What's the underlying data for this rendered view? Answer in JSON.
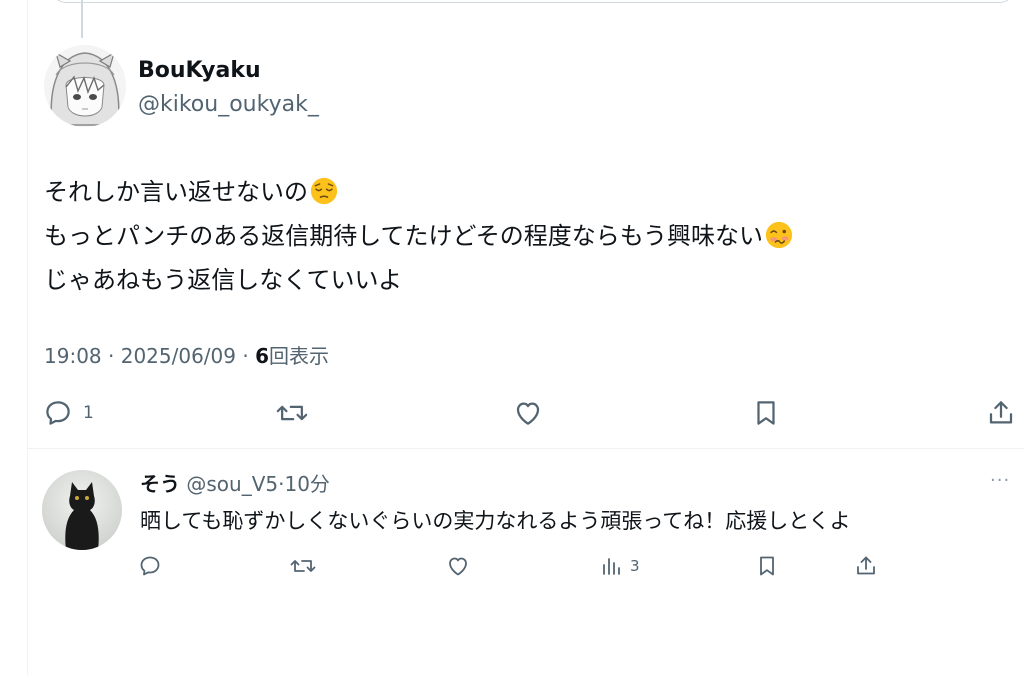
{
  "post": {
    "display_name": "BouKyaku",
    "handle": "@kikou_oukyak_",
    "lines": [
      {
        "text": "それしか言い返せないの",
        "emoji": "pensive-face"
      },
      {
        "text": "もっとパンチのある返信期待してたけどその程度ならもう興味ない",
        "emoji": "woozy-face"
      },
      {
        "text": "じゃあねもう返信しなくていいよ",
        "emoji": ""
      }
    ],
    "time": "19:08",
    "separator": "·",
    "date": "2025/06/09",
    "views_count": "6",
    "views_label": "回表示",
    "actions": {
      "reply_count": "1"
    }
  },
  "reply": {
    "display_name": "そう",
    "handle": "@sou_V5",
    "separator": "·",
    "time": "10分",
    "more": "···",
    "text": "晒しても恥ずかしくないぐらいの実力なれるよう頑張ってね！応援しとくよ",
    "actions": {
      "views_count": "3"
    }
  },
  "colors": {
    "text_primary": "#0f1419",
    "text_secondary": "#536471",
    "divider": "#eff3f4",
    "background": "#ffffff"
  },
  "icons": [
    "reply-icon",
    "retweet-icon",
    "like-icon",
    "bookmark-icon",
    "share-icon",
    "analytics-icon",
    "more-icon",
    "pensive-face-emoji",
    "woozy-face-emoji"
  ]
}
